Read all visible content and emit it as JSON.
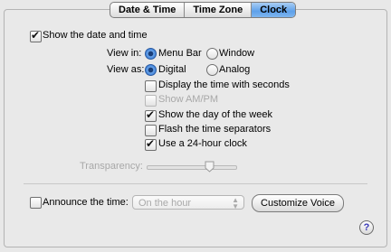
{
  "tabs": [
    {
      "label": "Date & Time",
      "active": false
    },
    {
      "label": "Time Zone",
      "active": false
    },
    {
      "label": "Clock",
      "active": true
    }
  ],
  "show_date_time": {
    "label": "Show the date and time",
    "checked": true
  },
  "view_in": {
    "label": "View in:",
    "options": [
      {
        "label": "Menu Bar",
        "selected": true
      },
      {
        "label": "Window",
        "selected": false
      }
    ]
  },
  "view_as": {
    "label": "View as:",
    "options": [
      {
        "label": "Digital",
        "selected": true
      },
      {
        "label": "Analog",
        "selected": false
      }
    ]
  },
  "options": [
    {
      "label": "Display the time with seconds",
      "checked": false,
      "enabled": true
    },
    {
      "label": "Show AM/PM",
      "checked": false,
      "enabled": false
    },
    {
      "label": "Show the day of the week",
      "checked": true,
      "enabled": true
    },
    {
      "label": "Flash the time separators",
      "checked": false,
      "enabled": true
    },
    {
      "label": "Use a 24-hour clock",
      "checked": true,
      "enabled": true
    }
  ],
  "transparency": {
    "label": "Transparency:",
    "value": 0.7,
    "enabled": false
  },
  "announce": {
    "label": "Announce the time:",
    "checked": false,
    "interval": "On the hour",
    "button": "Customize Voice"
  },
  "help_symbol": "?",
  "colors": {
    "accent": "#3c7fd8",
    "tab_active": "#5ea1ea",
    "background": "#e8e8e8"
  }
}
